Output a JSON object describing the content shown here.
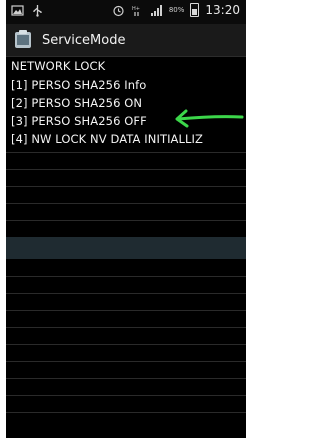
{
  "status_bar": {
    "battery_percent": "80%",
    "time": "13:20"
  },
  "title_bar": {
    "title": "ServiceMode"
  },
  "content": {
    "heading": "NETWORK LOCK",
    "items": [
      "[1] PERSO SHA256 Info",
      "[2] PERSO SHA256 ON",
      "[3] PERSO SHA256 OFF",
      "[4] NW LOCK NV DATA INITIALLIZ"
    ]
  },
  "colors": {
    "arrow": "#3cd64a",
    "highlight_row": "#1f2b31"
  },
  "icons": [
    "picture-icon",
    "usb-icon",
    "alarm-icon",
    "network-icon",
    "signal-icon",
    "battery-icon",
    "service-mode-app-icon",
    "green-arrow-annotation"
  ]
}
